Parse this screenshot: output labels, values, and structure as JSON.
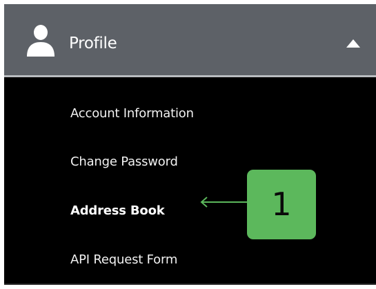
{
  "profile_section": {
    "title": "Profile",
    "user_icon": "user-icon",
    "toggle_icon": "chevron-up-icon"
  },
  "menu": {
    "items": [
      {
        "label": "Account Information",
        "active": false
      },
      {
        "label": "Change Password",
        "active": false
      },
      {
        "label": "Address Book",
        "active": true
      },
      {
        "label": "API Request Form",
        "active": false
      }
    ]
  },
  "annotation": {
    "step_number": "1",
    "arrow_icon": "arrow-left-icon"
  },
  "colors": {
    "header_bg": "#5d6167",
    "menu_bg": "#000000",
    "badge_bg": "#5cb85c",
    "arrow": "#5cb85c"
  }
}
